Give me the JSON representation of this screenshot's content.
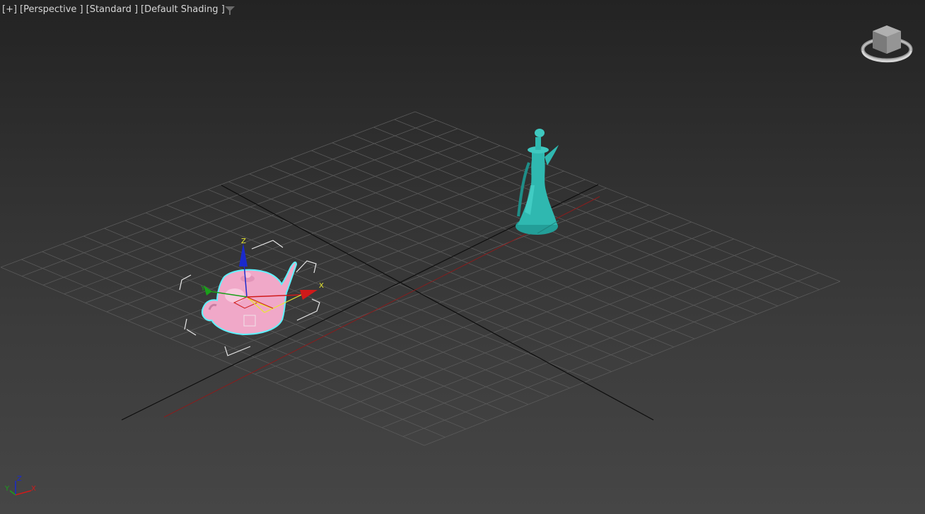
{
  "viewport": {
    "labels": [
      {
        "id": "plus",
        "text": "[+]"
      },
      {
        "id": "perspective",
        "text": "[Perspective ]"
      },
      {
        "id": "standard",
        "text": "[Standard ]"
      },
      {
        "id": "shading",
        "text": "[Default Shading ]"
      }
    ],
    "filter_icon": "filter-icon",
    "viewcube_icon": "viewcube-icon"
  },
  "gizmo": {
    "x_label": "X",
    "y_label": "Y",
    "z_label": "Z"
  },
  "axis_tripod": {
    "x_label": "X",
    "y_label": "Y",
    "z_label": "Z"
  },
  "colors": {
    "teapot": "#f0a8c8",
    "teapot_outline": "#5ff2ff",
    "vase": "#2fb8b0",
    "grid": "#5a5a5a",
    "axis_line": "#0d0d0d",
    "x_axis": "#d01a1a",
    "y_axis": "#1aa01a",
    "z_axis": "#1a2acc",
    "gizmo_label": "#e8e830"
  },
  "objects": [
    {
      "name": "teapot",
      "selected": true
    },
    {
      "name": "vase",
      "selected": false
    }
  ]
}
